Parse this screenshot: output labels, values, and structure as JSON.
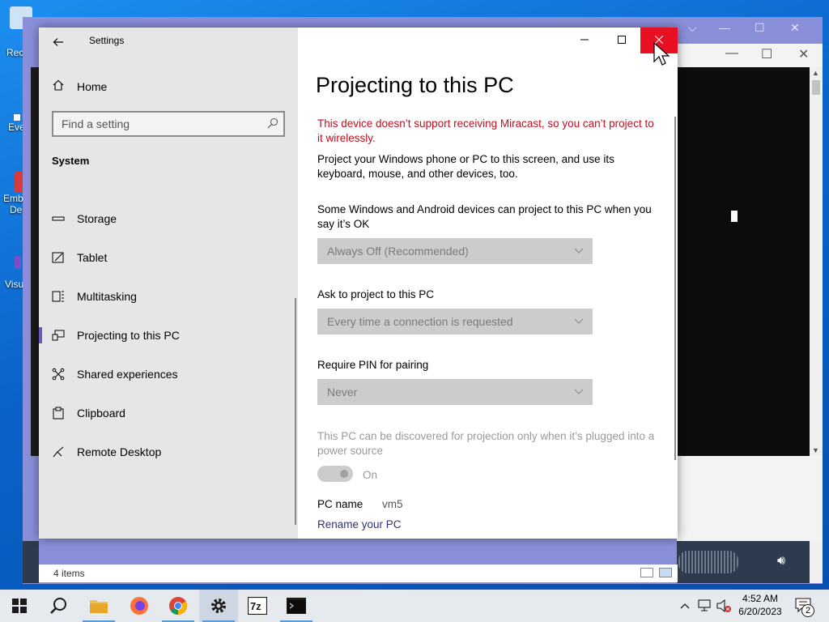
{
  "desktop": {
    "icons": [
      {
        "label": "Rec"
      },
      {
        "label": "Eve"
      },
      {
        "label": "Emb"
      },
      {
        "label": "De"
      },
      {
        "label": "Visu"
      }
    ]
  },
  "settings": {
    "app_title": "Settings",
    "home_label": "Home",
    "search_placeholder": "Find a setting",
    "section_label": "System",
    "nav_items": [
      {
        "label": "Storage",
        "icon": "storage-icon"
      },
      {
        "label": "Tablet",
        "icon": "tablet-icon"
      },
      {
        "label": "Multitasking",
        "icon": "multitasking-icon"
      },
      {
        "label": "Projecting to this PC",
        "icon": "projecting-icon",
        "active": true
      },
      {
        "label": "Shared experiences",
        "icon": "shared-experiences-icon"
      },
      {
        "label": "Clipboard",
        "icon": "clipboard-icon"
      },
      {
        "label": "Remote Desktop",
        "icon": "remote-desktop-icon"
      }
    ],
    "page": {
      "title": "Projecting to this PC",
      "warning": "This device doesn’t support receiving Miracast, so you can’t project to it wirelessly.",
      "intro": "Project your Windows phone or PC to this screen, and use its keyboard, mouse, and other devices, too.",
      "setting1_label": "Some Windows and Android devices can project to this PC when you say it’s OK",
      "setting1_value": "Always Off (Recommended)",
      "setting2_label": "Ask to project to this PC",
      "setting2_value": "Every time a connection is requested",
      "setting3_label": "Require PIN for pairing",
      "setting3_value": "Never",
      "power_note": "This PC can be discovered for projection only when it’s plugged into a power source",
      "toggle_state": "On",
      "pc_name_label": "PC name",
      "pc_name_value": "vm5",
      "rename_link": "Rename your PC"
    }
  },
  "explorer_status": {
    "items_count": "4 items"
  },
  "taskbar": {
    "apps": [
      "Start",
      "Search",
      "File Explorer",
      "Firefox",
      "Chrome",
      "Settings",
      "7-Zip",
      "Command Prompt"
    ],
    "time": "4:52 AM",
    "date": "6/20/2023",
    "notification_count": "2"
  },
  "colors": {
    "accent": "#6b59b8",
    "warning": "#c50f1f",
    "link": "#31307a",
    "close_red": "#e81123"
  }
}
